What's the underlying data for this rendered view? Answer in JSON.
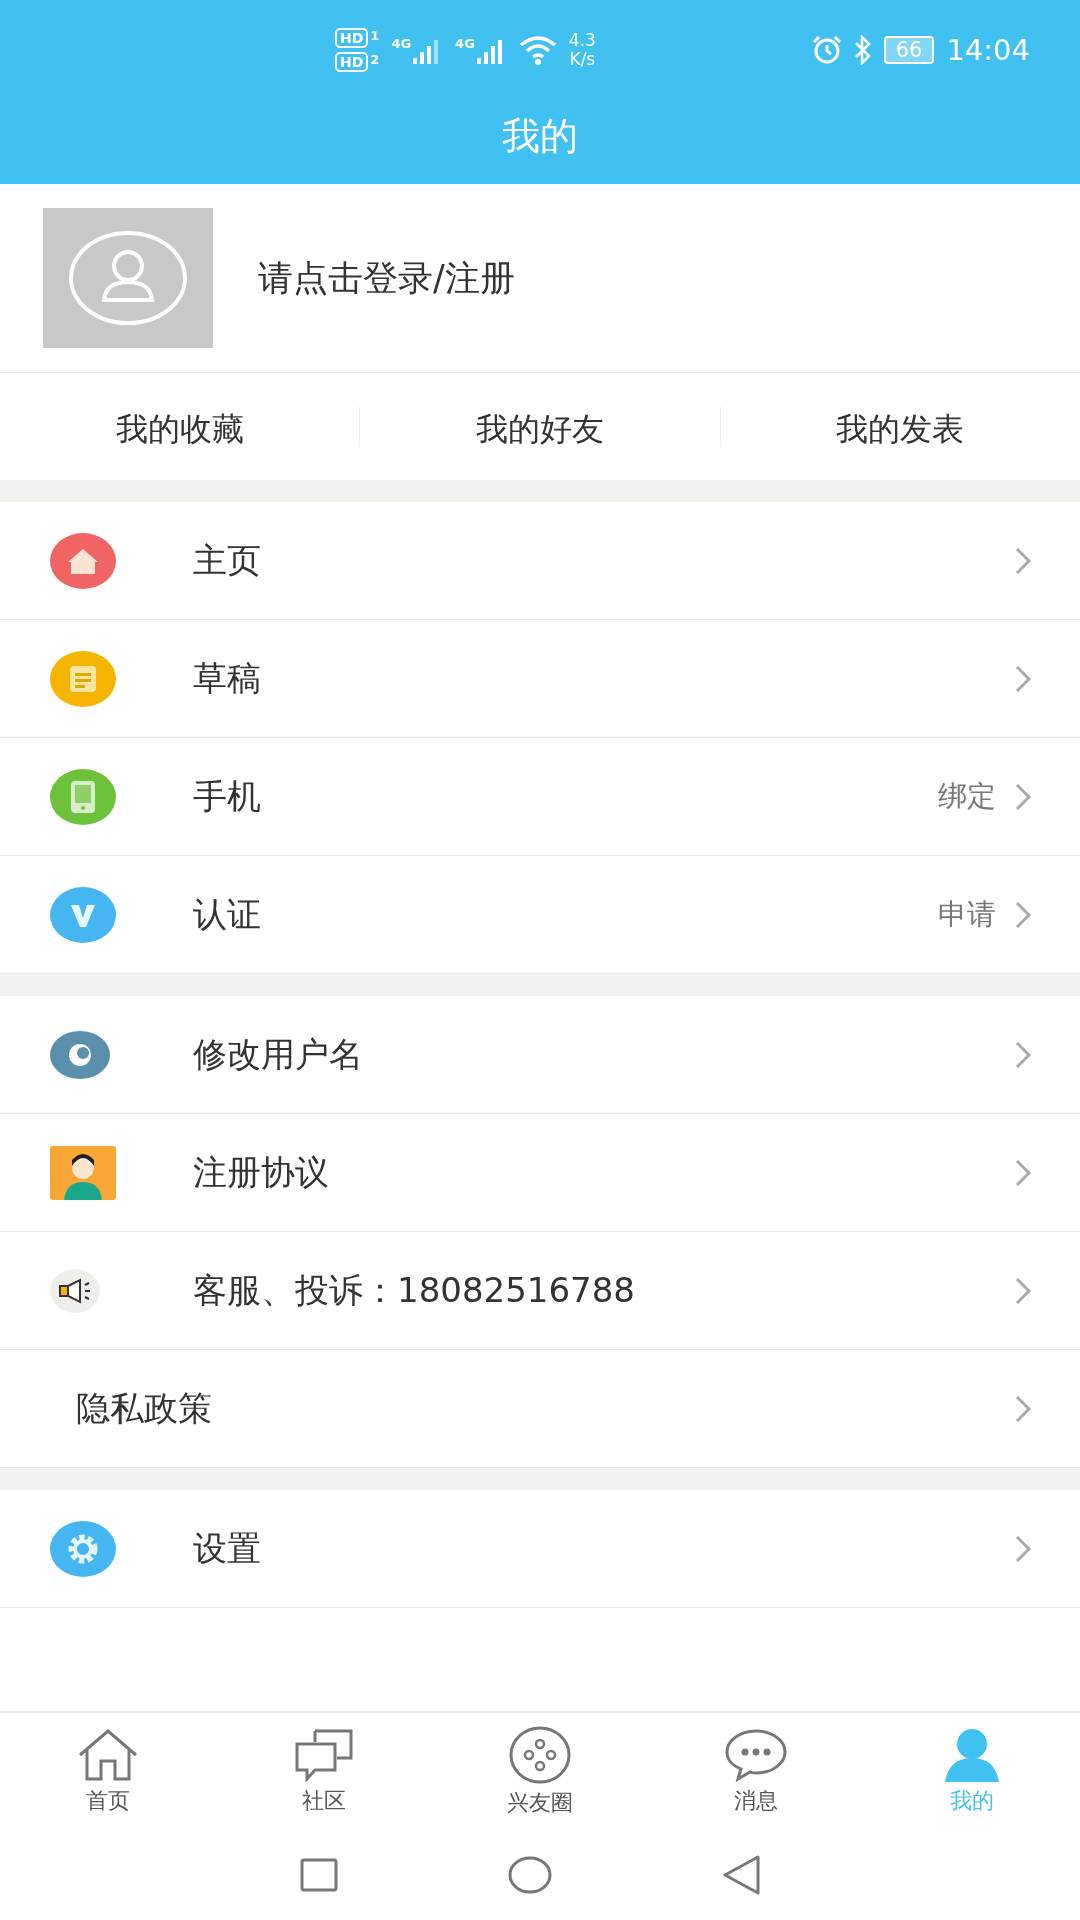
{
  "status_bar": {
    "sims": [
      {
        "label": "HD",
        "slot": "1"
      },
      {
        "label": "HD",
        "slot": "2"
      }
    ],
    "networks": [
      "4G",
      "4G"
    ],
    "speed_value": "4.3",
    "speed_unit": "K/s",
    "battery": "66",
    "time": "14:04"
  },
  "header": {
    "title": "我的"
  },
  "profile": {
    "login_prompt": "请点击登录/注册"
  },
  "shortcuts": [
    "我的收藏",
    "我的好友",
    "我的发表"
  ],
  "menu_groups": [
    [
      {
        "kind": "home",
        "label": "主页"
      },
      {
        "kind": "draft",
        "label": "草稿"
      },
      {
        "kind": "phone",
        "label": "手机",
        "value": "绑定"
      },
      {
        "kind": "verify",
        "label": "认证",
        "value": "申请"
      }
    ],
    [
      {
        "kind": "eye",
        "label": "修改用户名"
      },
      {
        "kind": "person",
        "label": "注册协议"
      },
      {
        "kind": "megaphone",
        "label": "客服、投诉：18082516788"
      },
      {
        "kind": "plain",
        "label": "隐私政策"
      }
    ],
    [
      {
        "kind": "gear",
        "label": "设置"
      }
    ]
  ],
  "bottom_nav": [
    {
      "kind": "home",
      "label": "首页",
      "selected": false
    },
    {
      "kind": "community",
      "label": "社区",
      "selected": false
    },
    {
      "kind": "circle",
      "label": "兴友圈",
      "selected": false
    },
    {
      "kind": "message",
      "label": "消息",
      "selected": false
    },
    {
      "kind": "me",
      "label": "我的",
      "selected": true
    }
  ]
}
